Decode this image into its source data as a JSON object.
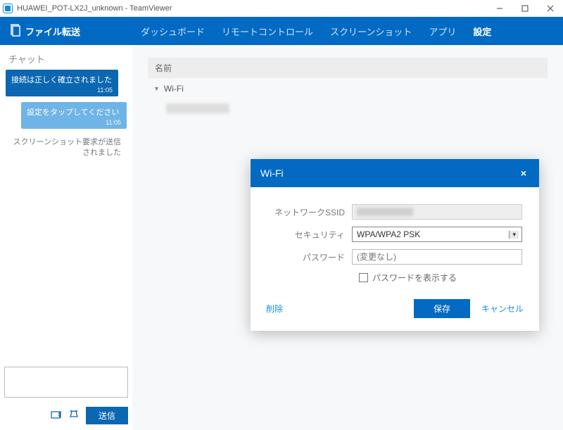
{
  "window": {
    "title": "HUAWEI_POT-LX2J_unknown - TeamViewer"
  },
  "header": {
    "file_transfer": "ファイル転送",
    "tabs": {
      "dashboard": "ダッシュボード",
      "remote": "リモートコントロール",
      "screenshot": "スクリーンショット",
      "app": "アプリ",
      "settings": "設定"
    }
  },
  "chat": {
    "title": "チャット",
    "msg1": {
      "text": "接続は正しく確立されました",
      "time": "11:05"
    },
    "msg2": {
      "text": "設定をタップしてください",
      "time": "11:05"
    },
    "system": "スクリーンショット要求が送信されました",
    "send": "送信"
  },
  "panel": {
    "name_header": "名前",
    "wifi_node": "Wi-Fi"
  },
  "dialog": {
    "title": "Wi-Fi",
    "labels": {
      "ssid": "ネットワークSSID",
      "security": "セキュリティ",
      "password": "パスワード"
    },
    "security_value": "WPA/WPA2 PSK",
    "password_placeholder": "(変更なし)",
    "show_password": "パスワードを表示する",
    "delete": "削除",
    "save": "保存",
    "cancel": "キャンセル"
  }
}
